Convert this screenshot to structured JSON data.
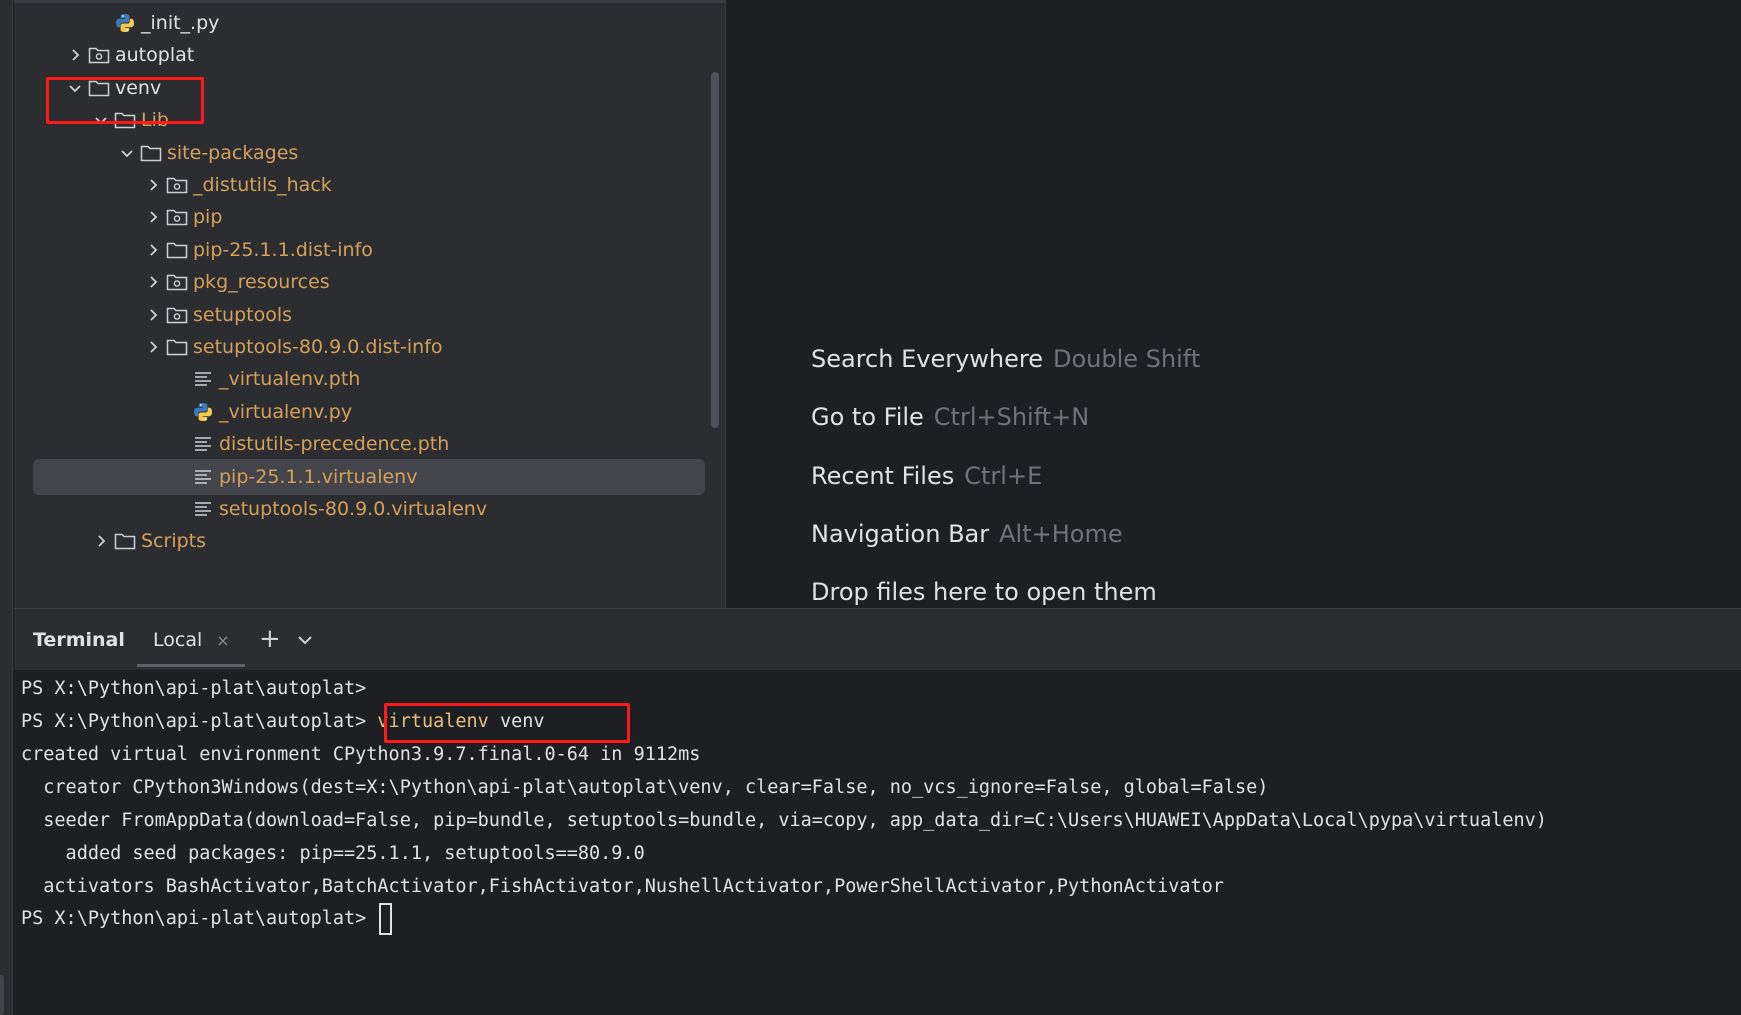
{
  "project_tree": {
    "rows": [
      {
        "label": "_init_.py",
        "icon": "python-file-icon",
        "chevron": "none",
        "indent": 3,
        "excluded": false
      },
      {
        "label": "autoplat",
        "icon": "package-folder-icon",
        "chevron": "right",
        "indent": 2,
        "excluded": false
      },
      {
        "label": "venv",
        "icon": "folder-icon",
        "chevron": "down",
        "indent": 2,
        "excluded": false
      },
      {
        "label": "Lib",
        "icon": "folder-icon",
        "chevron": "down",
        "indent": 3,
        "excluded": true
      },
      {
        "label": "site-packages",
        "icon": "folder-icon",
        "chevron": "down",
        "indent": 4,
        "excluded": true
      },
      {
        "label": "_distutils_hack",
        "icon": "package-folder-icon",
        "chevron": "right",
        "indent": 5,
        "excluded": true
      },
      {
        "label": "pip",
        "icon": "package-folder-icon",
        "chevron": "right",
        "indent": 5,
        "excluded": true
      },
      {
        "label": "pip-25.1.1.dist-info",
        "icon": "folder-icon",
        "chevron": "right",
        "indent": 5,
        "excluded": true
      },
      {
        "label": "pkg_resources",
        "icon": "package-folder-icon",
        "chevron": "right",
        "indent": 5,
        "excluded": true
      },
      {
        "label": "setuptools",
        "icon": "package-folder-icon",
        "chevron": "right",
        "indent": 5,
        "excluded": true
      },
      {
        "label": "setuptools-80.9.0.dist-info",
        "icon": "folder-icon",
        "chevron": "right",
        "indent": 5,
        "excluded": true
      },
      {
        "label": "_virtualenv.pth",
        "icon": "text-file-icon",
        "chevron": "none",
        "indent": 6,
        "excluded": true
      },
      {
        "label": "_virtualenv.py",
        "icon": "python-file-icon",
        "chevron": "none",
        "indent": 6,
        "excluded": true
      },
      {
        "label": "distutils-precedence.pth",
        "icon": "text-file-icon",
        "chevron": "none",
        "indent": 6,
        "excluded": true
      },
      {
        "label": "pip-25.1.1.virtualenv",
        "icon": "text-file-icon",
        "chevron": "none",
        "indent": 6,
        "excluded": true,
        "selected": true
      },
      {
        "label": "setuptools-80.9.0.virtualenv",
        "icon": "text-file-icon",
        "chevron": "none",
        "indent": 6,
        "excluded": true
      },
      {
        "label": "Scripts",
        "icon": "folder-icon",
        "chevron": "right",
        "indent": 3,
        "excluded": true
      }
    ]
  },
  "welcome": {
    "hints": [
      {
        "label": "Search Everywhere",
        "shortcut": "Double Shift"
      },
      {
        "label": "Go to File",
        "shortcut": "Ctrl+Shift+N"
      },
      {
        "label": "Recent Files",
        "shortcut": "Ctrl+E"
      },
      {
        "label": "Navigation Bar",
        "shortcut": "Alt+Home"
      },
      {
        "label": "Drop files here to open them",
        "shortcut": ""
      }
    ]
  },
  "terminal": {
    "title": "Terminal",
    "tab_label": "Local",
    "close_glyph": "×",
    "new_tab_glyph": "+",
    "lines": [
      {
        "text": "PS X:\\Python\\api-plat\\autoplat>",
        "cmd": ""
      },
      {
        "text": "PS X:\\Python\\api-plat\\autoplat> ",
        "cmd": "virtualenv",
        "rest": " venv"
      },
      {
        "text": "created virtual environment CPython3.9.7.final.0-64 in 9112ms",
        "cmd": ""
      },
      {
        "text": "  creator CPython3Windows(dest=X:\\Python\\api-plat\\autoplat\\venv, clear=False, no_vcs_ignore=False, global=False)",
        "cmd": ""
      },
      {
        "text": "  seeder FromAppData(download=False, pip=bundle, setuptools=bundle, via=copy, app_data_dir=C:\\Users\\HUAWEI\\AppData\\Local\\pypa\\virtualenv)",
        "cmd": ""
      },
      {
        "text": "    added seed packages: pip==25.1.1, setuptools==80.9.0",
        "cmd": ""
      },
      {
        "text": "  activators BashActivator,BatchActivator,FishActivator,NushellActivator,PowerShellActivator,PythonActivator",
        "cmd": ""
      },
      {
        "text": "PS X:\\Python\\api-plat\\autoplat> ",
        "cmd": "",
        "cursor": true
      }
    ]
  },
  "colors": {
    "excluded_folder": "#d4a05a",
    "command_highlight": "#e5c07b",
    "annotation_red": "#ff1a1a",
    "selection": "#43454a"
  }
}
